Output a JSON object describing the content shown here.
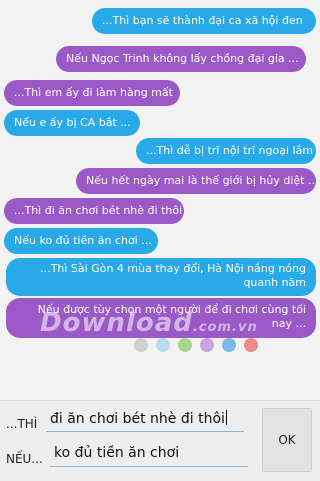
{
  "messages": [
    {
      "side": "right",
      "color": "blue",
      "text": "...Thì bạn sẽ thành đại ca xã hội đen"
    },
    {
      "side": "right",
      "color": "purple",
      "text": "Nếu Ngọc Trinh không lấy chồng đại gia ..."
    },
    {
      "side": "left",
      "color": "purple",
      "text": "...Thì em ấy đi làm hàng mất"
    },
    {
      "side": "left",
      "color": "blue",
      "text": "Nếu e ấy bị CA bắt ..."
    },
    {
      "side": "right",
      "color": "blue",
      "text": "...Thì dễ bị trĩ nội trĩ ngoại lắm"
    },
    {
      "side": "right",
      "color": "purple",
      "text": "Nếu hết ngày mai là thế giới bị hủy diệt ..."
    },
    {
      "side": "left",
      "color": "purple",
      "text": "...Thì đi ăn chơi bét nhè đi thôi"
    },
    {
      "side": "left",
      "color": "blue",
      "text": "Nếu ko đủ tiền ăn chơi ..."
    },
    {
      "side": "right",
      "color": "blue",
      "text": "...Thì Sài Gòn 4 mùa thay đổi, Hà Nội nắng nóng quanh năm"
    },
    {
      "side": "right",
      "color": "purple",
      "text": "Nếu được tùy chọn một người để đi chơi cùng tối nay ..."
    }
  ],
  "watermark": {
    "brand": "Download",
    "suffix": ".com.vn"
  },
  "color_dots": [
    "#cfcfcf",
    "#b8dcef",
    "#a8d890",
    "#c9a6e0",
    "#7fb8e8",
    "#f08a8a"
  ],
  "colors": {
    "blue": "#29a9e8",
    "purple": "#9b59c8"
  },
  "input": {
    "thi_label": "...THÌ",
    "thi_value": "đi ăn chơi bét nhè đi thôi",
    "neu_label": "NẾU...",
    "neu_value": "ko đủ tiền ăn chơi",
    "ok_label": "OK"
  }
}
